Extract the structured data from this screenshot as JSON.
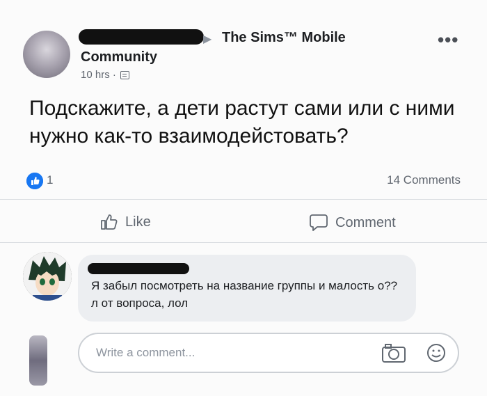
{
  "post": {
    "group_name": "The Sims™ Mobile",
    "community_label": "Community",
    "time": "10 hrs ·",
    "text": "Подскажите, а дети растут сами или с ними нужно как-то взаимодейстовать?",
    "like_count": "1",
    "comments_count": "14 Comments"
  },
  "actions": {
    "like_label": "Like",
    "comment_label": "Comment"
  },
  "comment": {
    "text": "Я забыл посмотреть на название группы и малость о??л от вопроса, лол"
  },
  "composer": {
    "placeholder": "Write a comment..."
  },
  "colors": {
    "accent": "#1877f2",
    "bubble": "#eceef1"
  },
  "icons": [
    "more-icon",
    "globe-icon",
    "like-badge-icon",
    "thumbs-up-icon",
    "comment-icon",
    "camera-icon",
    "smile-icon"
  ]
}
